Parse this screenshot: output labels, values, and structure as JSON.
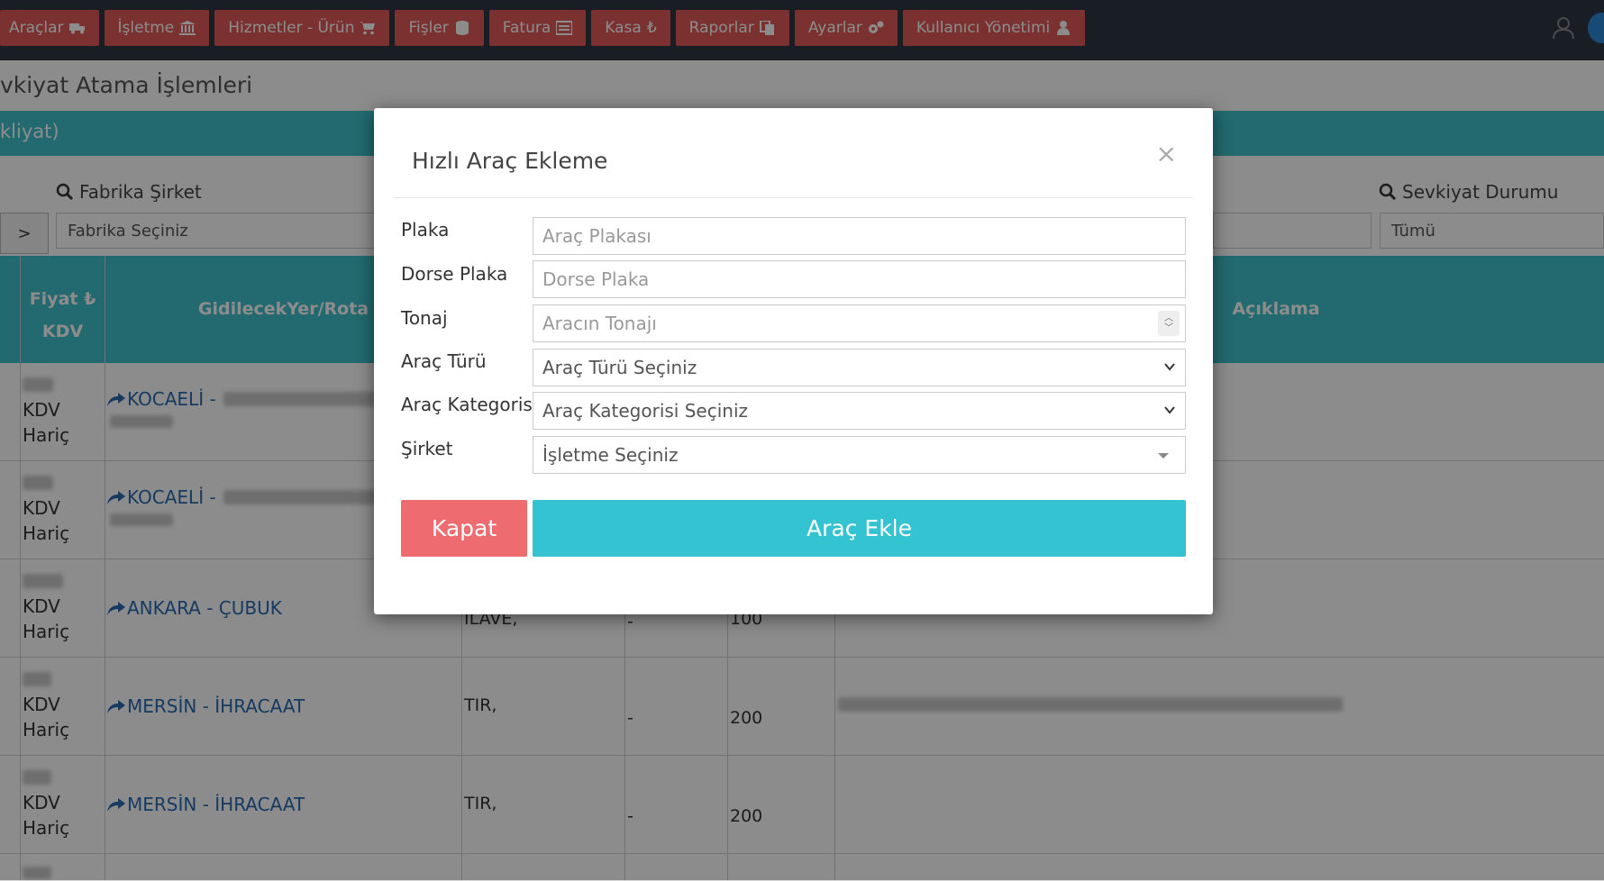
{
  "nav": {
    "items": [
      {
        "label": "Araçlar",
        "icon": "truck-icon"
      },
      {
        "label": "İşletme",
        "icon": "bank-icon"
      },
      {
        "label": "Hizmetler - Ürün",
        "icon": "cart-icon"
      },
      {
        "label": "Fişler",
        "icon": "database-icon"
      },
      {
        "label": "Fatura",
        "icon": "invoice-icon"
      },
      {
        "label": "Kasa",
        "icon": "lira-icon"
      },
      {
        "label": "Raporlar",
        "icon": "copy-icon"
      },
      {
        "label": "Ayarlar",
        "icon": "gears-icon"
      },
      {
        "label": "Kullanıcı Yönetimi",
        "icon": "user-icon"
      }
    ],
    "color": "#e25a5a"
  },
  "page": {
    "title": "vkiyat Atama İşlemleri",
    "bar_text": "kliyat)"
  },
  "filters": {
    "arrow": ">",
    "factory_label": "Fabrika Şirket",
    "factory_value": "Fabrika Seçiniz",
    "status_label": "Sevkiyat Durumu",
    "status_value": "Tümü"
  },
  "table": {
    "headers": {
      "price": "Fiyat ₺",
      "price_sub": "KDV",
      "route": "GidilecekYer/Rota",
      "desc": "Açıklama"
    },
    "rows": [
      {
        "kdv": "KDV",
        "kdv2": "Hariç",
        "route": "KOCAELİ -",
        "type": "",
        "dash": "",
        "qty": ""
      },
      {
        "kdv": "KDV",
        "kdv2": "Hariç",
        "route": "KOCAELİ -",
        "type": "",
        "dash": "",
        "qty": ""
      },
      {
        "kdv": "KDV",
        "kdv2": "Hariç",
        "route": "ANKARA - ÇUBUK",
        "type": "İLAVE,",
        "dash": "-",
        "qty": "100"
      },
      {
        "kdv": "KDV",
        "kdv2": "Hariç",
        "route": "MERSİN - İHRACAAT",
        "type": "TIR,",
        "dash": "-",
        "qty": "200"
      },
      {
        "kdv": "KDV",
        "kdv2": "Hariç",
        "route": "MERSİN - İHRACAAT",
        "type": "TIR,",
        "dash": "-",
        "qty": "200"
      }
    ]
  },
  "modal": {
    "title": "Hızlı Araç Ekleme",
    "close": "×",
    "fields": {
      "plaka_label": "Plaka",
      "plaka_placeholder": "Araç Plakası",
      "dorse_label": "Dorse Plaka",
      "dorse_placeholder": "Dorse Plaka",
      "tonaj_label": "Tonaj",
      "tonaj_placeholder": "Aracın Tonajı",
      "tur_label": "Araç Türü",
      "tur_value": "Araç Türü Seçiniz",
      "kategori_label": "Araç Kategorisi",
      "kategori_value": "Araç Kategorisi Seçiniz",
      "sirket_label": "Şirket",
      "sirket_value": "İşletme Seçiniz"
    },
    "close_button": "Kapat",
    "submit_button": "Araç Ekle",
    "close_color": "#ee6b70",
    "submit_color": "#33c3d1"
  }
}
